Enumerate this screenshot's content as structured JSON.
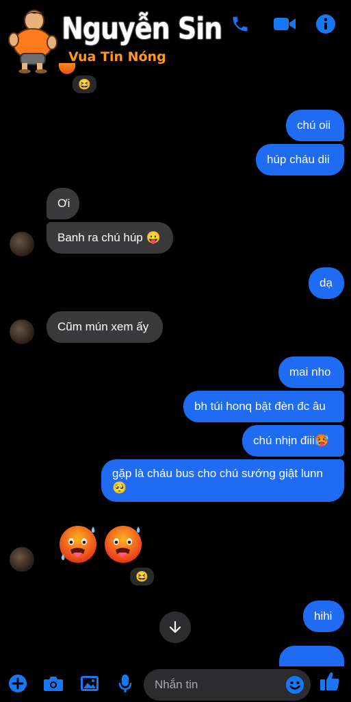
{
  "header": {
    "watermark_name": "Nguyễn Sin",
    "watermark_tagline": "Vua Tin Nóng",
    "icons": [
      "phone-icon",
      "video-call-icon",
      "info-icon"
    ]
  },
  "messages": {
    "top_reaction": "😆",
    "m1": "chú oii",
    "m2": "húp cháu dii",
    "m3": "Ơi",
    "m4": "Banh ra chú húp 😛",
    "m5": "dạ",
    "m6": "Cũm mún xem ấy",
    "m7": "mai nho",
    "m8": "bh túi honq bật đèn đc âu",
    "m9": "chú nhịn điii🥵",
    "m10_line1": "gặp là cháu bus cho chú sướng giật lunn",
    "m10_line2": "🥺",
    "emoji_reaction": "😆",
    "m11": "hihi"
  },
  "composer": {
    "placeholder": "Nhắn tin",
    "icons": [
      "plus-icon",
      "camera-icon",
      "gallery-icon",
      "microphone-icon",
      "emoji-icon",
      "thumbs-up-icon"
    ]
  },
  "colors": {
    "outgoing": "#1f6bf2",
    "incoming": "#3a3a3c",
    "accent": "#1877f2",
    "watermark_orange": "#ff9a1f"
  }
}
